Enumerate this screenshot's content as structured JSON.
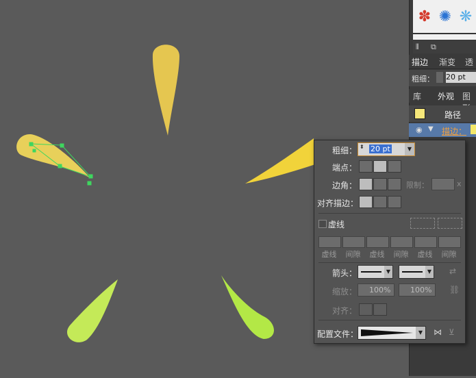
{
  "swatches": [
    "✽",
    "✺",
    "❋"
  ],
  "panel_tabs": [
    "描边",
    "渐变",
    "透"
  ],
  "stroke_weight": {
    "label": "粗细：",
    "value": "20 pt"
  },
  "appearance_tabs": [
    "库",
    "外观",
    "图形"
  ],
  "appearance": {
    "title": "路径",
    "stroke_item": "描边："
  },
  "popup": {
    "weight_label": "粗细：",
    "weight_value": "20 pt",
    "cap_label": "端点：",
    "corner_label": "边角：",
    "limit_label": "限制：",
    "limit_x": "x",
    "align_label": "对齐描边：",
    "dashed_label": "虚线",
    "dash_labels": [
      "虚线",
      "间隙",
      "虚线",
      "间隙",
      "虚线",
      "间隙"
    ],
    "arrow_label": "箭头：",
    "scale_label": "缩放：",
    "scale_values": [
      "100%",
      "100%"
    ],
    "align2_label": "对齐：",
    "profile_label": "配置文件："
  },
  "colors": {
    "canvas": "#5a5a5a",
    "petal_yellow": "#e6c74e",
    "petal_bright": "#f3d73d",
    "petal_green": "#b8e85a",
    "selection": "#3fd65f"
  }
}
